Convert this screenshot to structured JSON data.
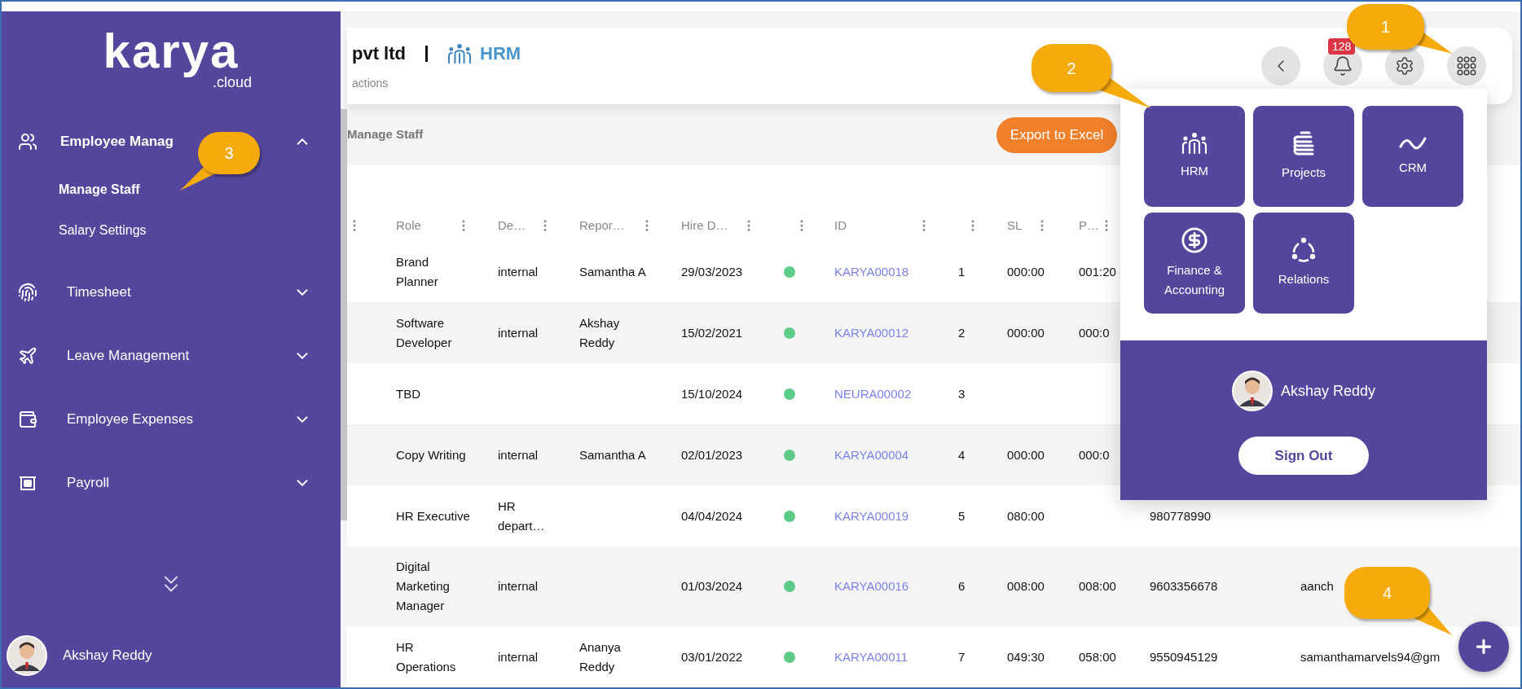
{
  "sidebar": {
    "logo": {
      "name": "karya",
      "suffix": ".cloud"
    },
    "items": [
      {
        "label": "Employee Manag",
        "expanded": true,
        "children": [
          {
            "label": "Manage Staff",
            "selected": true
          },
          {
            "label": "Salary Settings",
            "selected": false
          }
        ]
      },
      {
        "label": "Timesheet",
        "expanded": false
      },
      {
        "label": "Leave Management",
        "expanded": false
      },
      {
        "label": "Employee Expenses",
        "expanded": false
      },
      {
        "label": "Payroll",
        "expanded": false
      }
    ],
    "user": {
      "name": "Akshay Reddy"
    }
  },
  "header": {
    "company": "pvt ltd",
    "module": "HRM",
    "subtitle": "actions",
    "notifications": "128"
  },
  "breadcrumb": "Manage Staff",
  "export_button": "Export to Excel",
  "table": {
    "columns": [
      "Role",
      "De…",
      "Repor…",
      "Hire D…",
      "ID",
      "SL",
      "P…"
    ],
    "rows": [
      {
        "role": "Brand Planner",
        "department": "internal",
        "reports_to": "Samantha A",
        "hire_date": "29/03/2023",
        "active": true,
        "id": "KARYA00018",
        "number": "1",
        "sl": "000:00",
        "p": "001:20"
      },
      {
        "role": "Software Developer",
        "department": "internal",
        "reports_to": "Akshay Reddy",
        "hire_date": "15/02/2021",
        "active": true,
        "id": "KARYA00012",
        "number": "2",
        "sl": "000:00",
        "p": "000:0"
      },
      {
        "role": "TBD",
        "hire_date": "15/10/2024",
        "active": true,
        "id": "NEURA00002",
        "number": "3"
      },
      {
        "role": "Copy Writing",
        "department": "internal",
        "reports_to": "Samantha A",
        "hire_date": "02/01/2023",
        "active": true,
        "id": "KARYA00004",
        "number": "4",
        "sl": "000:00",
        "p": "000:0"
      },
      {
        "role": "HR Executive",
        "department": "HR depart…",
        "hire_date": "04/04/2024",
        "active": true,
        "id": "KARYA00019",
        "number": "5",
        "sl": "080:00",
        "phone": "980778990"
      },
      {
        "role": "Digital Marketing Manager",
        "department": "internal",
        "hire_date": "01/03/2024",
        "active": true,
        "id": "KARYA00016",
        "number": "6",
        "sl": "008:00",
        "p": "008:00",
        "phone": "9603356678",
        "email": "aanch"
      },
      {
        "role": "HR Operations",
        "department": "internal",
        "reports_to": "Ananya Reddy",
        "hire_date": "03/01/2022",
        "active": true,
        "id": "KARYA00011",
        "number": "7",
        "sl": "049:30",
        "p": "058:00",
        "phone": "9550945129",
        "email": "samanthamarvels94@gm"
      }
    ]
  },
  "module_menu": {
    "modules": [
      "HRM",
      "Projects",
      "CRM",
      "Finance & Accounting",
      "Relations"
    ],
    "user": "Akshay Reddy",
    "sign_out": "Sign Out"
  },
  "callouts": [
    "1",
    "2",
    "3",
    "4"
  ]
}
